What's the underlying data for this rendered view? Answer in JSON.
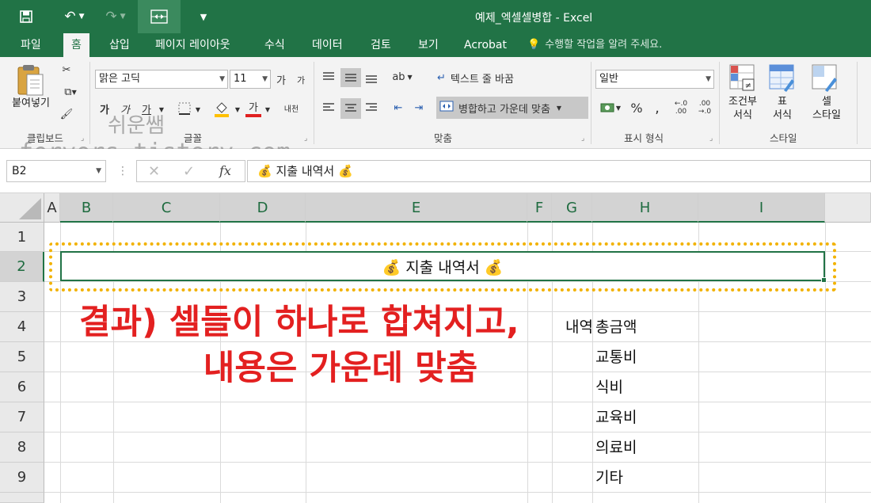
{
  "window": {
    "title": "예제_엑셀셀병합 - Excel"
  },
  "tabs": [
    {
      "label": "파일",
      "active": false
    },
    {
      "label": "홈",
      "active": true
    },
    {
      "label": "삽입",
      "active": false
    },
    {
      "label": "페이지 레이아웃",
      "active": false
    },
    {
      "label": "수식",
      "active": false
    },
    {
      "label": "데이터",
      "active": false
    },
    {
      "label": "검토",
      "active": false
    },
    {
      "label": "보기",
      "active": false
    },
    {
      "label": "Acrobat",
      "active": false
    }
  ],
  "tell_me": "수행할 작업을 알려 주세요.",
  "ribbon": {
    "clipboard": {
      "paste_label": "붙여넣기",
      "group_label": "클립보드"
    },
    "font": {
      "font_name": "맑은 고딕",
      "font_size": "11",
      "grow_label": "가",
      "shrink_label": "가",
      "bold_label": "가",
      "italic_label": "가",
      "underline_label": "가",
      "font_color_label": "가",
      "phonetic_label": "내천",
      "group_label": "글꼴"
    },
    "alignment": {
      "wrap_text_label": "텍스트 줄 바꿈",
      "merge_center_label": "병합하고 가운데 맞춤",
      "group_label": "맞춤"
    },
    "number": {
      "format": "일반",
      "percent_label": "%",
      "comma_label": ",",
      "inc_decimal_label": "←.0 .00",
      "dec_decimal_label": ".00 →.0",
      "group_label": "표시 형식"
    },
    "styles": {
      "conditional_label": "조건부\n서식",
      "table_label": "표\n서식",
      "cell_style_label": "셀\n스타일",
      "group_label": "스타일"
    }
  },
  "formula_bar": {
    "name_box": "B2",
    "formula": "💰 지출 내역서 💰"
  },
  "sheet": {
    "columns": [
      "A",
      "B",
      "C",
      "D",
      "E",
      "F",
      "G",
      "H",
      "I"
    ],
    "selected_columns": [
      "B",
      "C",
      "D",
      "E",
      "F",
      "G",
      "H",
      "I"
    ],
    "rows": [
      "1",
      "2",
      "3",
      "4",
      "5",
      "6",
      "7",
      "8",
      "9"
    ],
    "selected_row": "2",
    "merged_cell": {
      "range": "B2",
      "value": "💰 지출 내역서 💰"
    },
    "cells": [
      {
        "ref": "G4",
        "value": "내역"
      },
      {
        "ref": "H4",
        "value": "총금액"
      },
      {
        "ref": "H5",
        "value": "교통비"
      },
      {
        "ref": "H6",
        "value": "식비"
      },
      {
        "ref": "H7",
        "value": "교육비"
      },
      {
        "ref": "H8",
        "value": "의료비"
      },
      {
        "ref": "H9",
        "value": "기타"
      }
    ]
  },
  "annotation": {
    "line1": "결과) 셀들이 하나로 합쳐지고,",
    "line2": "내용은 가운데 맞춤",
    "color": "#e32020"
  },
  "watermark": {
    "line1": "쉬운쌤",
    "line2": "fervors.tistory.com"
  },
  "colors": {
    "excel_green": "#217346",
    "highlight_dotted": "#f2b200"
  }
}
